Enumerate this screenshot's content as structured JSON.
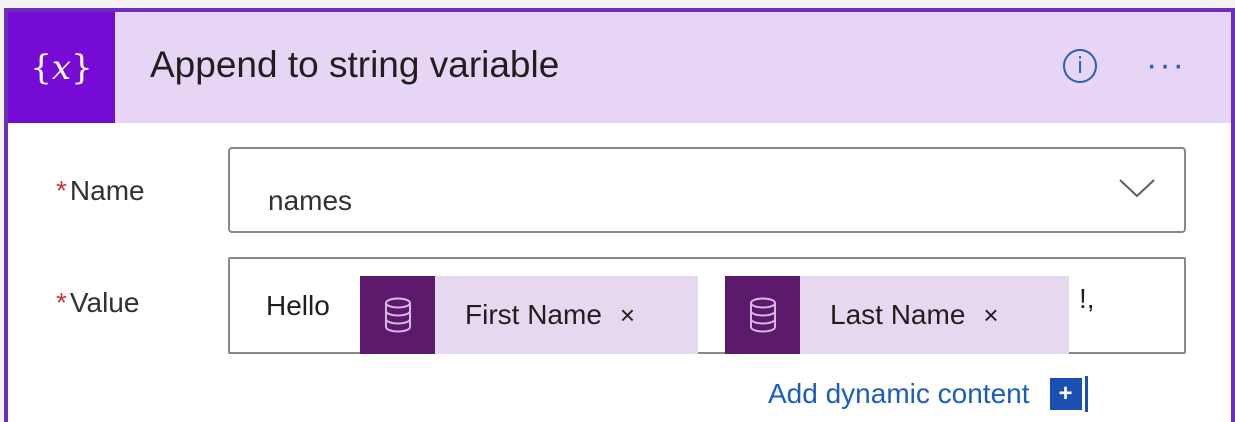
{
  "card": {
    "title": "Append to string variable",
    "icon_text_left": "{",
    "icon_text_x": "x",
    "icon_text_right": "}",
    "info_icon": "i",
    "more_icon": "···"
  },
  "fields": {
    "name": {
      "required_mark": "*",
      "label": "Name",
      "value": "names"
    },
    "value": {
      "required_mark": "*",
      "label": "Value",
      "prefix_text": "Hello",
      "tokens": [
        {
          "label": "First Name",
          "close": "×",
          "icon": "database-icon"
        },
        {
          "label": "Last Name",
          "close": "×",
          "icon": "database-icon"
        }
      ],
      "suffix_text": "!,"
    }
  },
  "dynamic_content": {
    "label": "Add dynamic content",
    "button": "+"
  },
  "colors": {
    "header_bg": "#e6d5f5",
    "icon_bg": "#770bd6",
    "token_icon_bg": "#5b1a6b",
    "token_bg": "#e6d8ee",
    "link": "#1a5ebd",
    "required": "#d13438"
  }
}
